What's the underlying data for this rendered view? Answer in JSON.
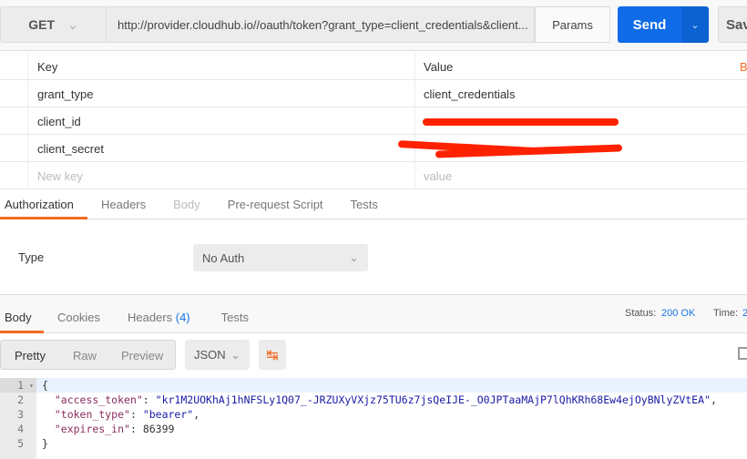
{
  "request": {
    "method": "GET",
    "url": "http://provider.cloudhub.io//oauth/token?grant_type=client_credentials&client...",
    "params_label": "Params",
    "send_label": "Send",
    "save_label": "Sav"
  },
  "params_table": {
    "key_header": "Key",
    "value_header": "Value",
    "bulk_edit": "B",
    "rows": [
      {
        "key": "grant_type",
        "value": "client_credentials"
      },
      {
        "key": "client_id",
        "value": ""
      },
      {
        "key": "client_secret",
        "value": ""
      }
    ],
    "new_key_placeholder": "New key",
    "new_value_placeholder": "value"
  },
  "request_tabs": [
    "Authorization",
    "Headers",
    "Body",
    "Pre-request Script",
    "Tests"
  ],
  "auth": {
    "type_label": "Type",
    "type_value": "No Auth"
  },
  "response_tabs": {
    "body": "Body",
    "cookies": "Cookies",
    "headers": "Headers",
    "headers_count": "(4)",
    "tests": "Tests"
  },
  "status": {
    "label": "Status:",
    "value": "200 OK",
    "time_label": "Time:",
    "time_value": "2"
  },
  "view": {
    "pretty": "Pretty",
    "raw": "Raw",
    "preview": "Preview",
    "format": "JSON"
  },
  "code": {
    "lines": [
      "1",
      "2",
      "3",
      "4",
      "5"
    ],
    "open": "{",
    "close": "}",
    "access_token_key": "\"access_token\"",
    "access_token_val": "\"kr1M2UOKhAj1hNFSLy1Q07_-JRZUXyVXjz75TU6z7jsQeIJE-_O0JPTaaMAjP7lQhKRh68Ew4ejOyBNlyZVtEA\"",
    "token_type_key": "\"token_type\"",
    "token_type_val": "\"bearer\"",
    "expires_in_key": "\"expires_in\"",
    "expires_in_val": "86399"
  },
  "colors": {
    "accent": "#f26b21",
    "send": "#0f6ce6",
    "link": "#1a73e8"
  }
}
